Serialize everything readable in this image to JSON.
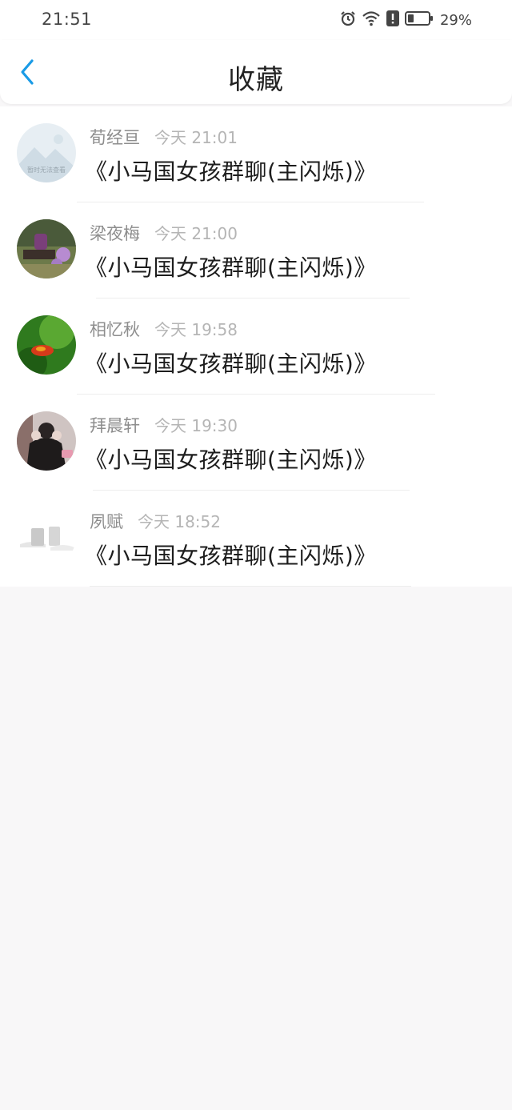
{
  "status_bar": {
    "time": "21:51",
    "battery_percent": "29%",
    "icons": [
      "alarm-icon",
      "wifi-icon",
      "alert-icon",
      "battery-icon"
    ]
  },
  "header": {
    "title": "收藏",
    "back_icon": "chevron-left-icon"
  },
  "colors": {
    "accent": "#1a9be6",
    "author": "#8e8e8e",
    "time": "#b5b5b5",
    "background": "#f8f7f8"
  },
  "favorites": [
    {
      "author": "荀经亘",
      "time": "今天 21:01",
      "title": "《小马国女孩群聊(主闪烁)》",
      "avatar_text": "暂时无法查看"
    },
    {
      "author": "梁夜梅",
      "time": "今天 21:00",
      "title": "《小马国女孩群聊(主闪烁)》"
    },
    {
      "author": "相忆秋",
      "time": "今天 19:58",
      "title": "《小马国女孩群聊(主闪烁)》"
    },
    {
      "author": "拜晨轩",
      "time": "今天 19:30",
      "title": "《小马国女孩群聊(主闪烁)》"
    },
    {
      "author": "夙赋",
      "time": "今天 18:52",
      "title": "《小马国女孩群聊(主闪烁)》"
    }
  ]
}
